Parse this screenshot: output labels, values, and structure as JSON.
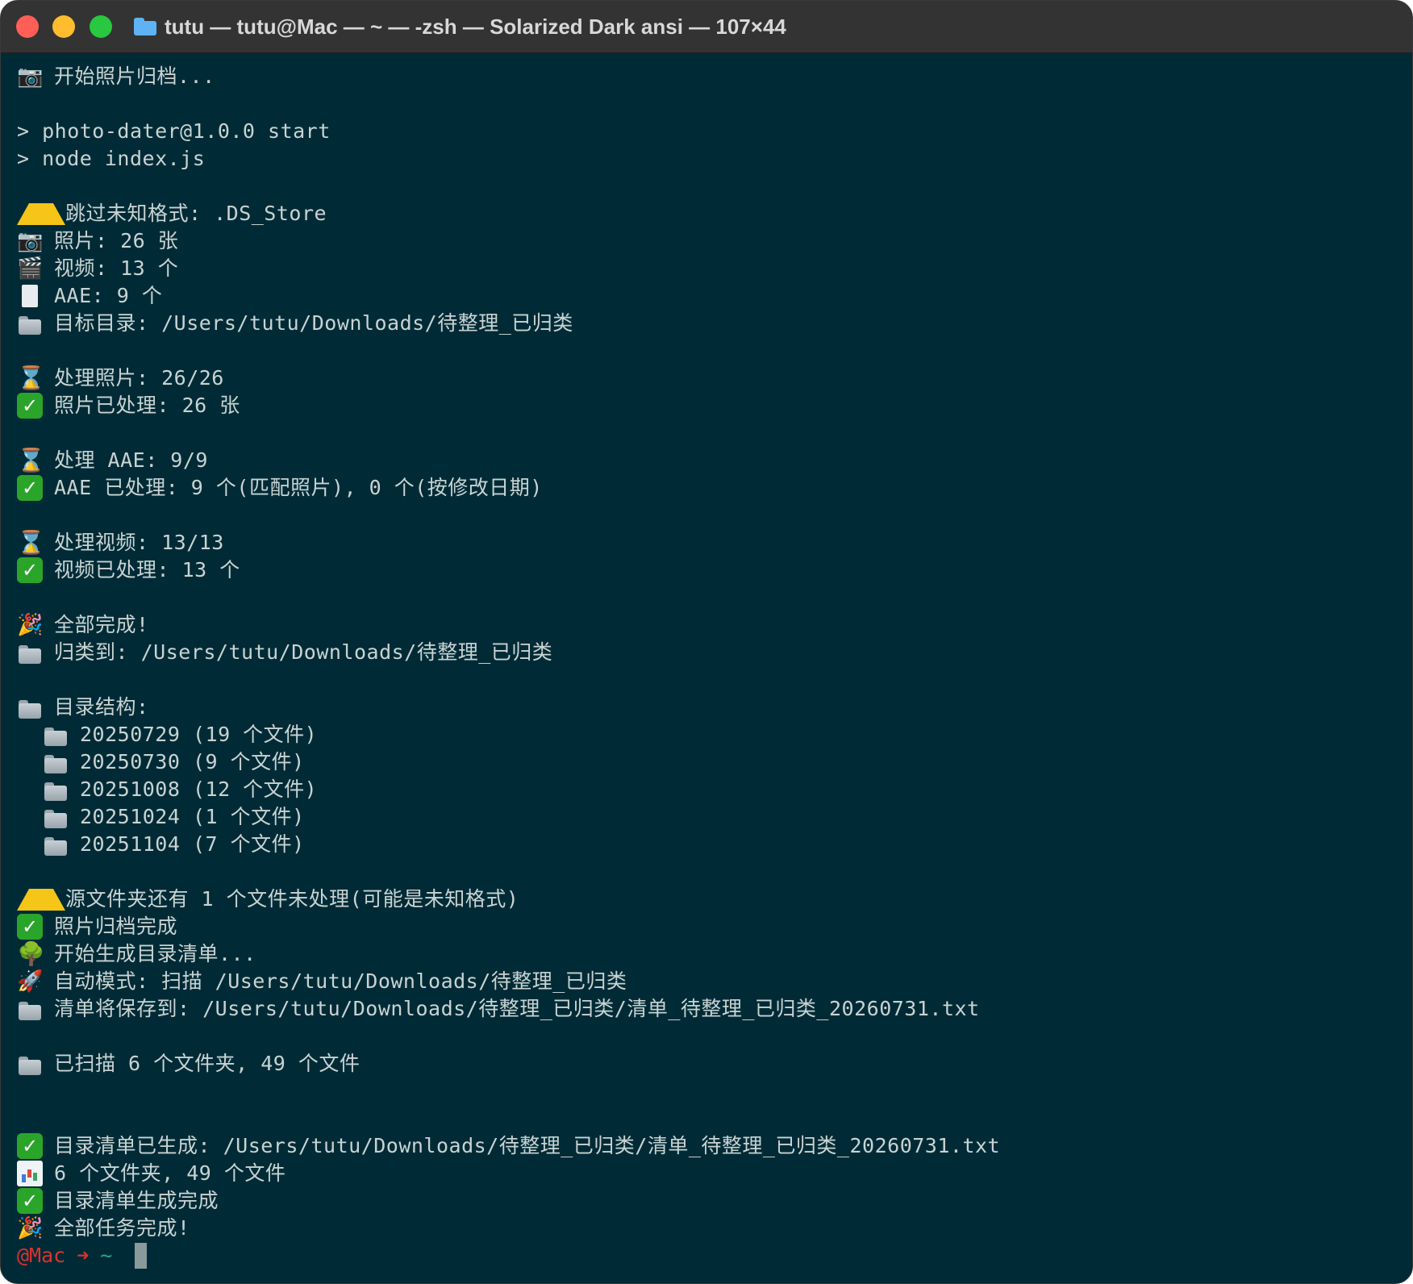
{
  "window": {
    "title": "tutu — tutu@Mac — ~ — -zsh — Solarized Dark ansi — 107×44",
    "traffic_lights": {
      "close_color": "#ff5f57",
      "minimize_color": "#febc2e",
      "zoom_color": "#28c840"
    },
    "title_icon": "folder-icon",
    "title_icon_color": "#5fb3f5"
  },
  "terminal": {
    "background": "#002b36",
    "foreground": "#c9d3d3",
    "lines": [
      {
        "icon": "camera-icon",
        "text": "开始照片归档..."
      },
      {
        "blank": true
      },
      {
        "text": "> photo-dater@1.0.0 start"
      },
      {
        "text": "> node index.js"
      },
      {
        "blank": true
      },
      {
        "icon": "warning-icon",
        "text": "跳过未知格式: .DS_Store"
      },
      {
        "icon": "camera-icon",
        "text": "照片: 26 张"
      },
      {
        "icon": "clapper-icon",
        "text": "视频: 13 个"
      },
      {
        "icon": "document-icon",
        "text": "AAE: 9 个"
      },
      {
        "icon": "folder-icon",
        "text": "目标目录: /Users/tutu/Downloads/待整理_已归类"
      },
      {
        "blank": true
      },
      {
        "icon": "hourglass-icon",
        "text": "处理照片: 26/26"
      },
      {
        "icon": "check-icon",
        "text": "照片已处理: 26 张"
      },
      {
        "blank": true
      },
      {
        "icon": "hourglass-icon",
        "text": "处理 AAE: 9/9"
      },
      {
        "icon": "check-icon",
        "text": "AAE 已处理: 9 个(匹配照片), 0 个(按修改日期)"
      },
      {
        "blank": true
      },
      {
        "icon": "hourglass-icon",
        "text": "处理视频: 13/13"
      },
      {
        "icon": "check-icon",
        "text": "视频已处理: 13 个"
      },
      {
        "blank": true
      },
      {
        "icon": "party-icon",
        "text": "全部完成!"
      },
      {
        "icon": "folder-icon",
        "text": "归类到: /Users/tutu/Downloads/待整理_已归类"
      },
      {
        "blank": true
      },
      {
        "icon": "folder-icon",
        "text": "目录结构:"
      },
      {
        "indent": true,
        "icon": "folder-icon",
        "text": "20250729 (19 个文件)"
      },
      {
        "indent": true,
        "icon": "folder-icon",
        "text": "20250730 (9 个文件)"
      },
      {
        "indent": true,
        "icon": "folder-icon",
        "text": "20251008 (12 个文件)"
      },
      {
        "indent": true,
        "icon": "folder-icon",
        "text": "20251024 (1 个文件)"
      },
      {
        "indent": true,
        "icon": "folder-icon",
        "text": "20251104 (7 个文件)"
      },
      {
        "blank": true
      },
      {
        "icon": "warning-icon",
        "text": "源文件夹还有 1 个文件未处理(可能是未知格式)"
      },
      {
        "icon": "check-icon",
        "text": "照片归档完成"
      },
      {
        "icon": "tree-icon",
        "text": "开始生成目录清单..."
      },
      {
        "icon": "rocket-icon",
        "text": "自动模式: 扫描 /Users/tutu/Downloads/待整理_已归类"
      },
      {
        "icon": "folder-icon",
        "text": "清单将保存到: /Users/tutu/Downloads/待整理_已归类/清单_待整理_已归类_20260731.txt"
      },
      {
        "blank": true
      },
      {
        "icon": "folder-icon",
        "text": "已扫描 6 个文件夹, 49 个文件"
      },
      {
        "blank": true
      },
      {
        "blank": true
      },
      {
        "icon": "check-icon",
        "text": "目录清单已生成: /Users/tutu/Downloads/待整理_已归类/清单_待整理_已归类_20260731.txt"
      },
      {
        "icon": "bar-chart-icon",
        "text": "6 个文件夹, 49 个文件"
      },
      {
        "icon": "check-icon",
        "text": "目录清单生成完成"
      },
      {
        "icon": "party-icon",
        "text": "全部任务完成!"
      }
    ],
    "prompt": {
      "host": "@Mac",
      "arrow": "➜",
      "cwd": "~",
      "host_color": "#dc322f",
      "cwd_color": "#2aa198"
    }
  }
}
